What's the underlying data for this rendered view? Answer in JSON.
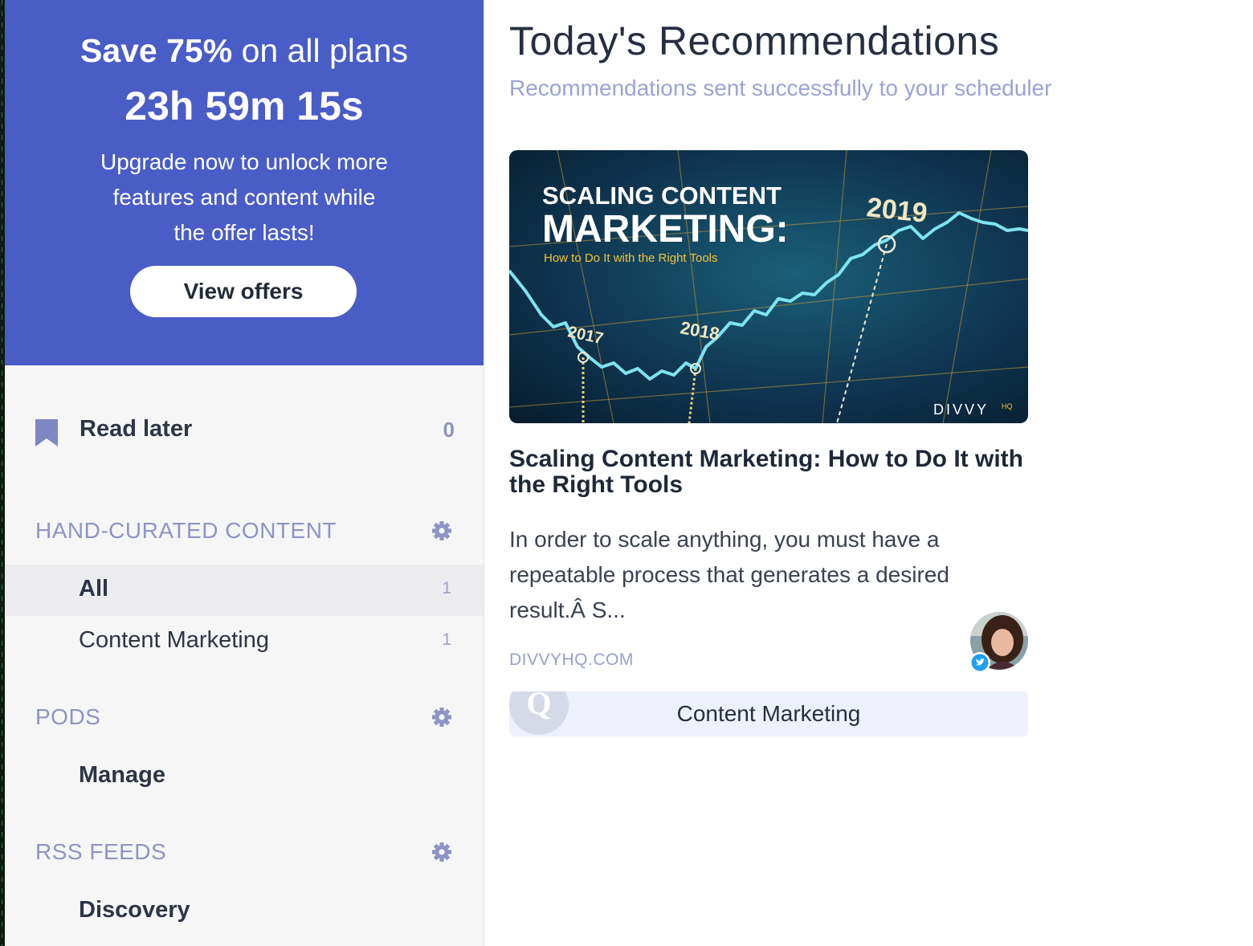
{
  "promo": {
    "headline_bold": "Save 75%",
    "headline_rest": " on all plans",
    "countdown": "23h 59m 15s",
    "body_line1": "Upgrade now to unlock more",
    "body_line2": "features and content while",
    "body_line3": "the offer lasts!",
    "button_label": "View offers",
    "bg_color": "#4a5cc6"
  },
  "sidebar": {
    "read_later": {
      "label": "Read later",
      "count": "0",
      "icon": "bookmark-icon"
    },
    "sections": [
      {
        "title": "HAND-CURATED CONTENT",
        "icon": "gear-icon",
        "items": [
          {
            "label": "All",
            "count": "1",
            "active": true
          },
          {
            "label": "Content Marketing",
            "count": "1",
            "active": false
          }
        ]
      },
      {
        "title": "PODS",
        "icon": "gear-icon",
        "items": [
          {
            "label": "Manage"
          }
        ]
      },
      {
        "title": "RSS FEEDS",
        "icon": "gear-icon",
        "items": [
          {
            "label": "Discovery"
          }
        ]
      }
    ]
  },
  "main": {
    "title": "Today's Recommendations",
    "subtitle": "Recommendations sent successfully to your scheduler",
    "card": {
      "image": {
        "line1": "SCALING CONTENT",
        "line2": "MARKETING:",
        "line3": "How to Do It with the Right Tools",
        "year1": "2017",
        "year2": "2018",
        "year3": "2019",
        "brand": "DIVVY",
        "brand_sup": "HQ"
      },
      "title": "Scaling Content Marketing: How to Do It with the Right Tools",
      "excerpt": "In order to scale anything, you must have a repeatable process that generates a desired result.Â S...",
      "source": "DIVVYHQ.COM",
      "tag": "Content Marketing"
    }
  },
  "colors": {
    "accent": "#4a5cc6",
    "muted_text": "#8e94c4",
    "twitter_blue": "#1da1f2"
  }
}
